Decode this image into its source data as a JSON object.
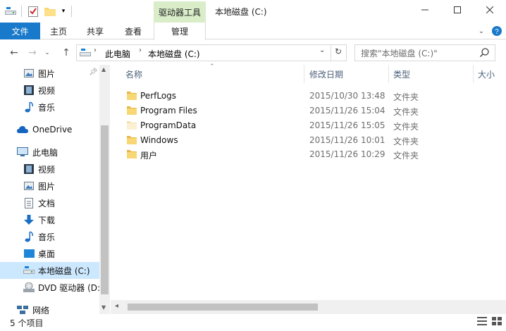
{
  "titlebar": {
    "context_tab": "驱动器工具",
    "title": "本地磁盘 (C:)",
    "minimize_icon": "minimize-icon",
    "maximize_icon": "maximize-icon",
    "close_icon": "close-icon"
  },
  "ribbon": {
    "tabs": [
      "文件",
      "主页",
      "共享",
      "查看",
      "管理"
    ]
  },
  "address": {
    "path": [
      "此电脑",
      "本地磁盘 (C:)"
    ],
    "search_placeholder": "搜索\"本地磁盘 (C:)\""
  },
  "nav": {
    "items": [
      {
        "label": "图片",
        "icon": "pictures-icon"
      },
      {
        "label": "视频",
        "icon": "videos-icon"
      },
      {
        "label": "音乐",
        "icon": "music-icon"
      },
      {
        "label": "OneDrive",
        "icon": "onedrive-icon"
      },
      {
        "label": "此电脑",
        "icon": "this-pc-icon"
      },
      {
        "label": "视频",
        "icon": "videos-icon"
      },
      {
        "label": "图片",
        "icon": "pictures-icon"
      },
      {
        "label": "文档",
        "icon": "documents-icon"
      },
      {
        "label": "下载",
        "icon": "downloads-icon"
      },
      {
        "label": "音乐",
        "icon": "music-icon"
      },
      {
        "label": "桌面",
        "icon": "desktop-icon"
      },
      {
        "label": "本地磁盘 (C:)",
        "icon": "local-disk-icon"
      },
      {
        "label": "DVD 驱动器 (D:",
        "icon": "dvd-drive-icon"
      },
      {
        "label": "网络",
        "icon": "network-icon"
      }
    ]
  },
  "columns": [
    "名称",
    "修改日期",
    "类型",
    "大小"
  ],
  "files": [
    {
      "name": "PerfLogs",
      "date": "2015/10/30 13:48",
      "type": "文件夹"
    },
    {
      "name": "Program Files",
      "date": "2015/11/26 15:04",
      "type": "文件夹"
    },
    {
      "name": "ProgramData",
      "date": "2015/11/26 15:05",
      "type": "文件夹"
    },
    {
      "name": "Windows",
      "date": "2015/11/26 10:01",
      "type": "文件夹"
    },
    {
      "name": "用户",
      "date": "2015/11/26 10:29",
      "type": "文件夹"
    }
  ],
  "status": {
    "count": "5 个项目"
  },
  "colors": {
    "accent": "#1979ca",
    "context_tab": "#d8edc8",
    "selected": "#cce8ff",
    "folder": "#f8d775"
  }
}
